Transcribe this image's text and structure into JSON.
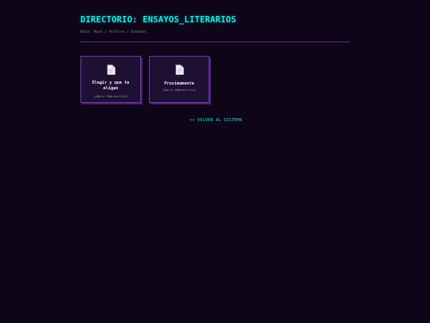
{
  "directory": {
    "title": "DIRECTORIO: ENSAYOS_LITERARIOS",
    "breadcrumb": "Ruta: Root / Archivo / Ensayos"
  },
  "files": [
    {
      "title": "Elegir y que te eligan",
      "subtitle": "[Abrir Manuscrito]",
      "icon": "document-icon"
    },
    {
      "title": "Proximamente",
      "subtitle": "[Abrir Manuscrito]",
      "icon": "document-icon"
    }
  ],
  "nav": {
    "back_label": "<< VOLVER AL SISTEMA"
  },
  "colors": {
    "background": "#0f0518",
    "accent": "#1de9e3",
    "card_border": "#6b3aa6",
    "card_bg": "#1e1032",
    "divider": "#5b2d86"
  }
}
